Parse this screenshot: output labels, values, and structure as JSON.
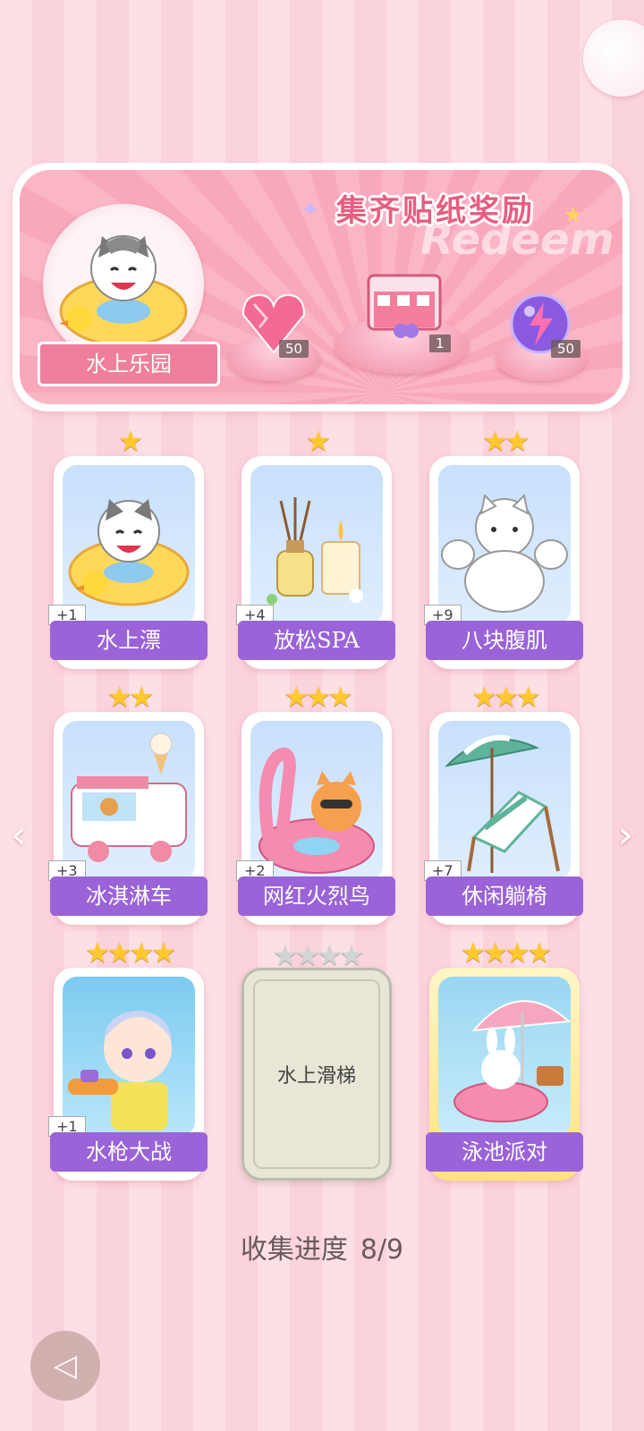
{
  "banner": {
    "title": "集齐贴纸奖励",
    "watermark": "Redeem",
    "theme_name": "水上乐园",
    "rewards": [
      {
        "icon": "pink-diamond-icon",
        "count": "50"
      },
      {
        "icon": "gift-box-icon",
        "count": "1"
      },
      {
        "icon": "energy-orb-icon",
        "count": "50"
      }
    ]
  },
  "stickers": [
    {
      "name": "水上漂",
      "stars": "★",
      "plus": "+1",
      "art": "cat-swim-ring"
    },
    {
      "name": "放松SPA",
      "stars": "★",
      "plus": "+4",
      "art": "aroma-candle"
    },
    {
      "name": "八块腹肌",
      "stars": "★★",
      "plus": "+9",
      "art": "muscle-cat"
    },
    {
      "name": "冰淇淋车",
      "stars": "★★",
      "plus": "+3",
      "art": "ice-cream-truck"
    },
    {
      "name": "网红火烈鸟",
      "stars": "★★★",
      "plus": "+2",
      "art": "flamingo-float"
    },
    {
      "name": "休闲躺椅",
      "stars": "★★★",
      "plus": "+7",
      "art": "beach-chair"
    },
    {
      "name": "水枪大战",
      "stars": "★★★★",
      "plus": "+1",
      "art": "water-gun-boy"
    },
    {
      "name": "水上滑梯",
      "stars": "★★★★",
      "locked": true
    },
    {
      "name": "泳池派对",
      "stars": "★★★★",
      "art": "pool-party-bunny"
    }
  ],
  "progress": {
    "label": "收集进度",
    "value": "8/9"
  },
  "colors": {
    "accent": "#9a63d8",
    "pink": "#ef7f9a",
    "star": "#ffc92e"
  }
}
